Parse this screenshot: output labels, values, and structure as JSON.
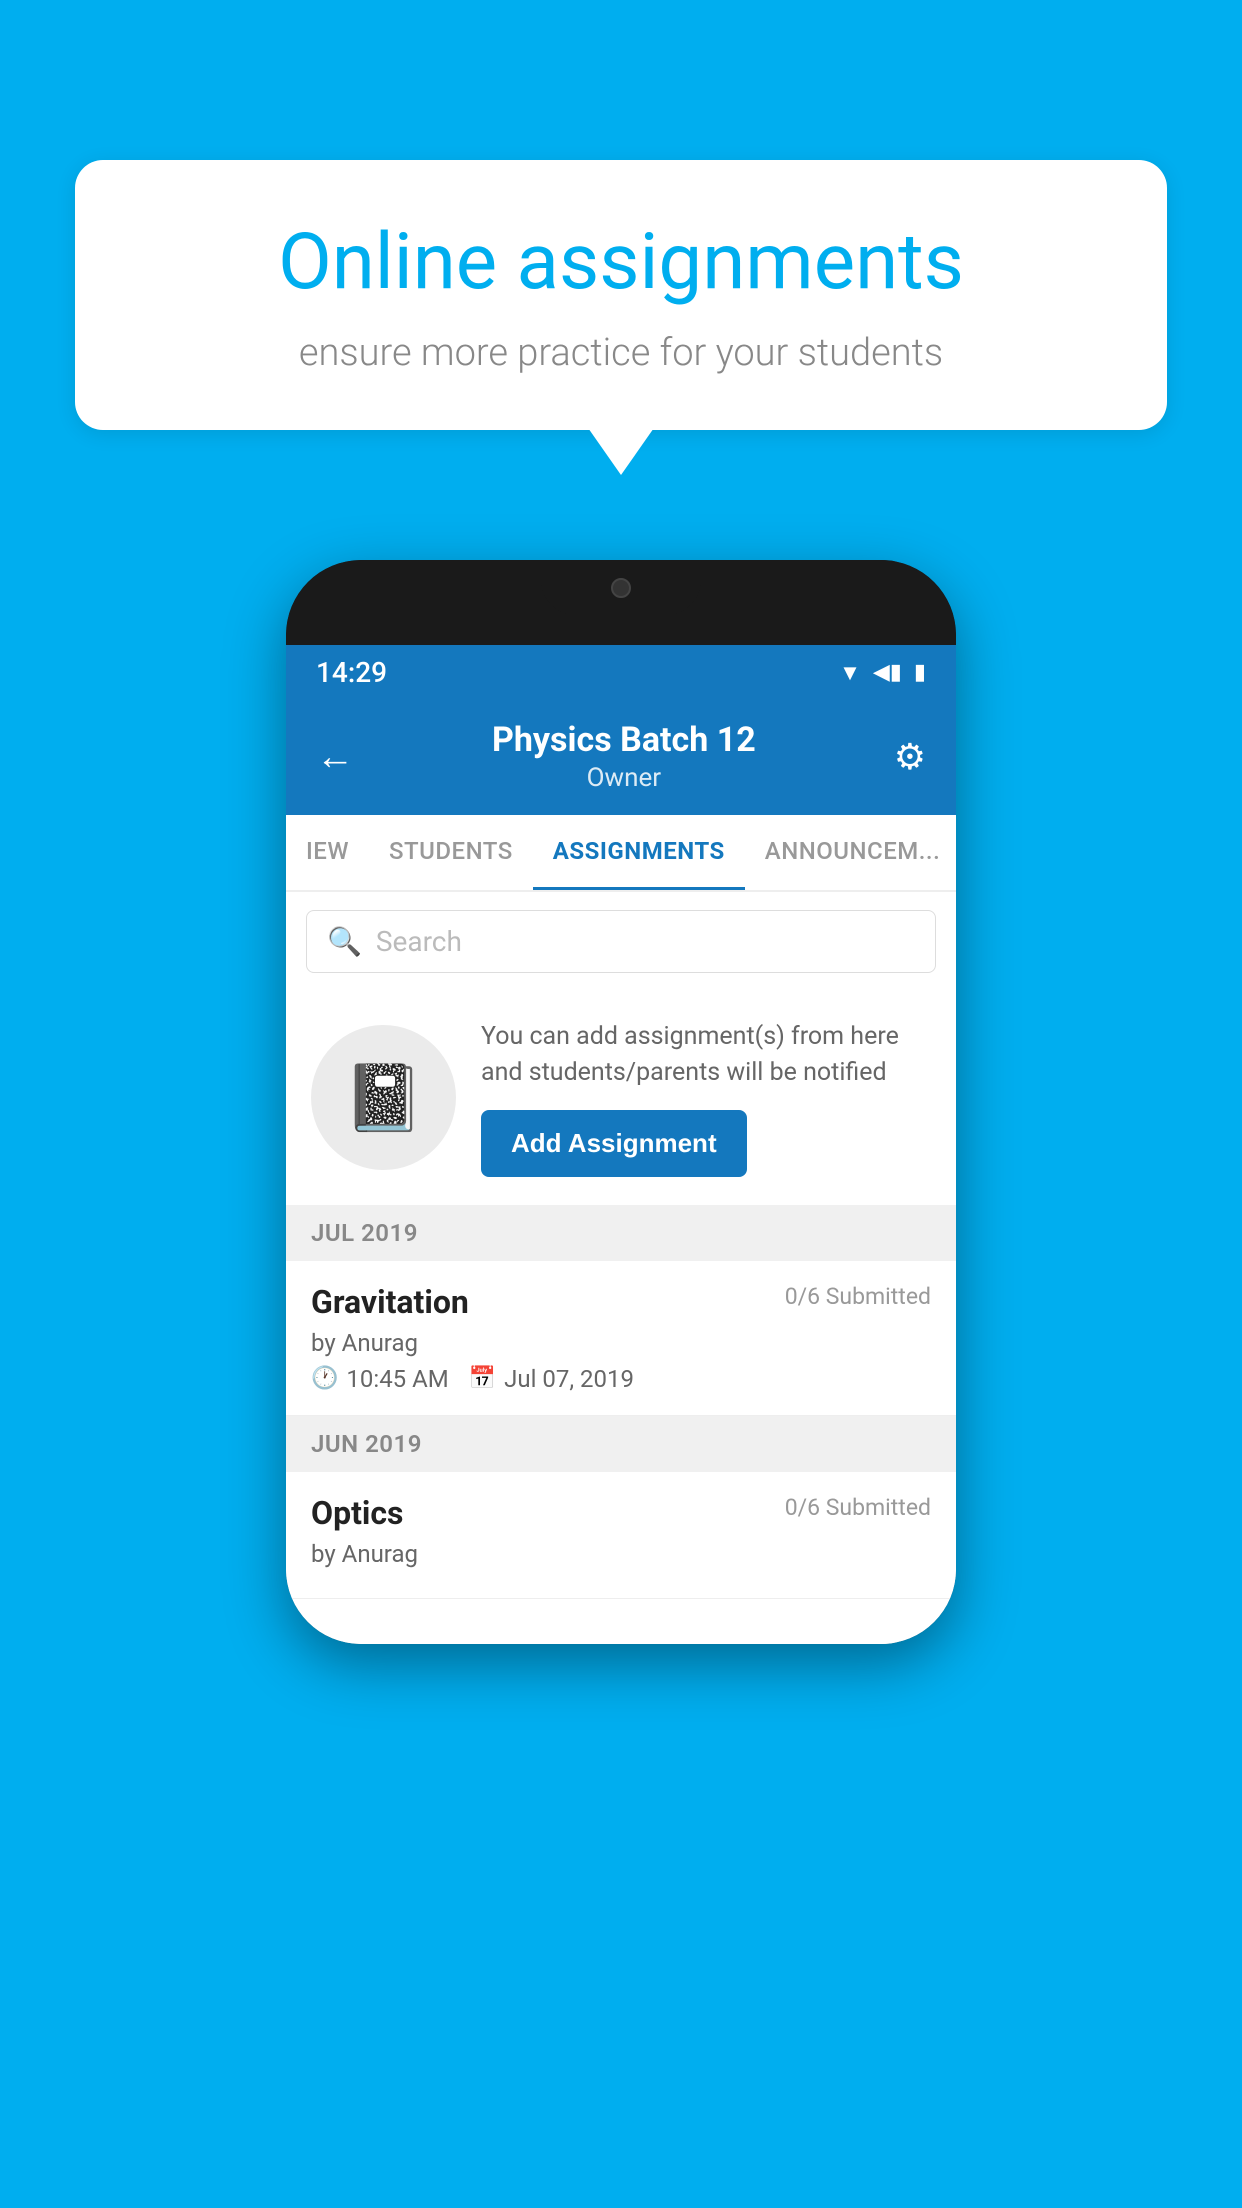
{
  "background": {
    "color": "#00AEEF"
  },
  "promo": {
    "title": "Online assignments",
    "subtitle": "ensure more practice for your students"
  },
  "phone": {
    "status_bar": {
      "time": "14:29"
    },
    "header": {
      "title": "Physics Batch 12",
      "subtitle": "Owner",
      "back_label": "←",
      "settings_label": "⚙"
    },
    "tabs": [
      {
        "label": "IEW",
        "active": false
      },
      {
        "label": "STUDENTS",
        "active": false
      },
      {
        "label": "ASSIGNMENTS",
        "active": true
      },
      {
        "label": "ANNOUNCEM...",
        "active": false
      }
    ],
    "search": {
      "placeholder": "Search"
    },
    "add_assignment": {
      "description": "You can add assignment(s) from here and students/parents will be notified",
      "button_label": "Add Assignment"
    },
    "sections": [
      {
        "header": "JUL 2019",
        "assignments": [
          {
            "name": "Gravitation",
            "submitted": "0/6 Submitted",
            "by": "by Anurag",
            "time": "10:45 AM",
            "date": "Jul 07, 2019"
          }
        ]
      },
      {
        "header": "JUN 2019",
        "assignments": [
          {
            "name": "Optics",
            "submitted": "0/6 Submitted",
            "by": "by Anurag",
            "time": "",
            "date": ""
          }
        ]
      }
    ]
  }
}
